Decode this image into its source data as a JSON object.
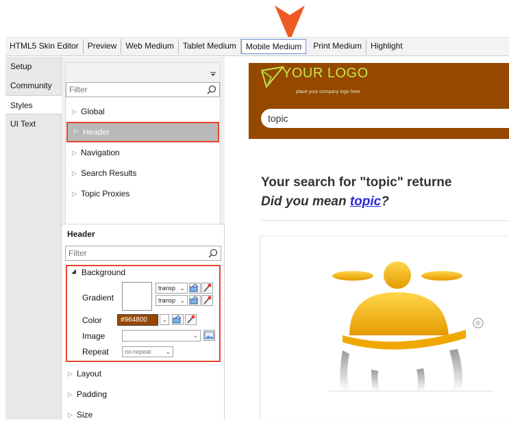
{
  "toolbar": {
    "items": [
      "HTML5 Skin Editor",
      "Preview",
      "Web Medium",
      "Tablet Medium",
      "Mobile Medium",
      "Print Medium",
      "Highlight"
    ],
    "active": "Mobile Medium"
  },
  "left_tabs": [
    "Setup",
    "Community",
    "Styles",
    "UI Text"
  ],
  "left_tabs_selected": "Styles",
  "style_tree": {
    "filter_placeholder": "Filter",
    "items": [
      "Global",
      "Header",
      "Navigation",
      "Search Results",
      "Topic Proxies"
    ],
    "selected": "Header"
  },
  "properties": {
    "section_title": "Header",
    "filter_placeholder": "Filter",
    "background": {
      "label": "Background",
      "gradient_label": "Gradient",
      "gradient_stop_1": "transp",
      "gradient_stop_2": "transp",
      "color_label": "Color",
      "color_value": "#964800",
      "image_label": "Image",
      "image_value": "",
      "repeat_label": "Repeat",
      "repeat_value": "no-repeat"
    },
    "more_items": [
      "Layout",
      "Padding",
      "Size"
    ]
  },
  "preview": {
    "logo_text": "YOUR LOGO",
    "logo_sub": "place your company logo here",
    "search_value": "topic",
    "result_title": "Your search for \"topic\" returne",
    "did_you_mean_prefix": "Did you mean ",
    "did_you_mean_link": "topic",
    "did_you_mean_suffix": "?",
    "registered_mark": "®"
  },
  "colors": {
    "header_brown": "#964800",
    "highlight_red": "#e2462b",
    "marker_orange": "#ee5a24",
    "logo_green": "#c2e84a",
    "mascot_yellow": "#f5b800"
  }
}
